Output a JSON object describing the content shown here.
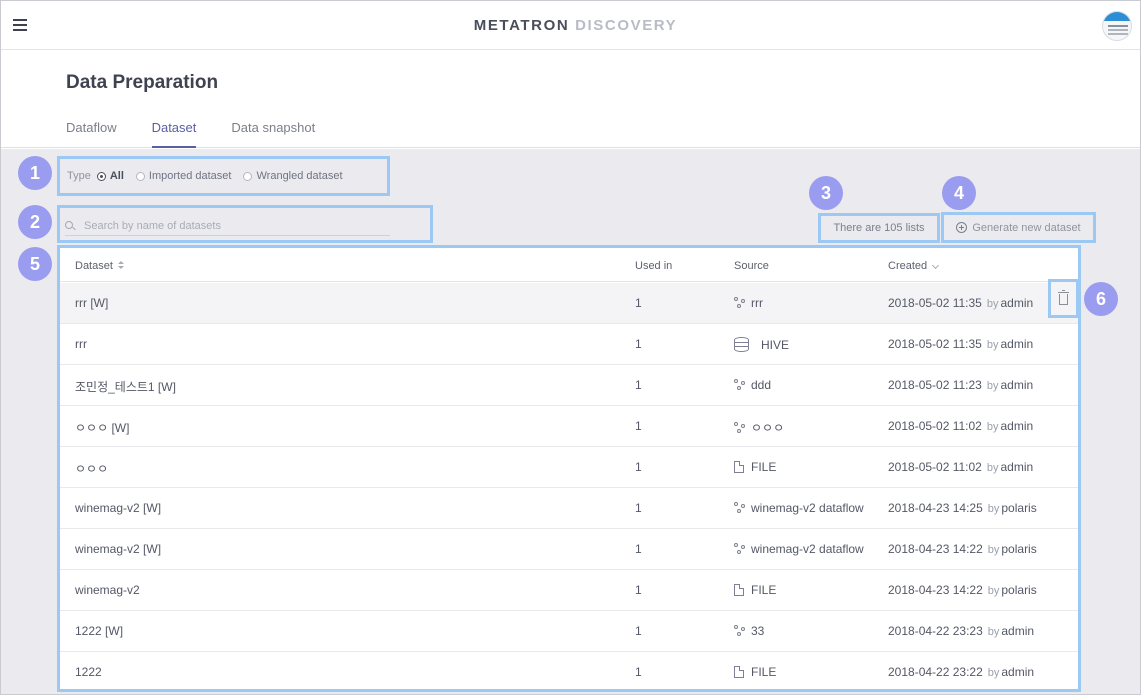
{
  "topbar": {
    "brand_primary": "METATRON",
    "brand_secondary": "DISCOVERY",
    "menu_icon": "hamburger-icon",
    "avatar_icon": "user-avatar"
  },
  "page": {
    "title": "Data Preparation",
    "tabs": [
      {
        "label": "Dataflow",
        "active": false
      },
      {
        "label": "Dataset",
        "active": true
      },
      {
        "label": "Data snapshot",
        "active": false
      }
    ]
  },
  "filter": {
    "type_label": "Type",
    "options": [
      {
        "label": "All",
        "checked": true
      },
      {
        "label": "Imported dataset",
        "checked": false
      },
      {
        "label": "Wrangled dataset",
        "checked": false
      }
    ]
  },
  "search": {
    "placeholder": "Search by name of datasets",
    "value": ""
  },
  "list_count": "There are 105 lists",
  "generate_button": "Generate new dataset",
  "table": {
    "columns": {
      "dataset": "Dataset",
      "used_in": "Used in",
      "source": "Source",
      "created": "Created"
    },
    "by_label": "by",
    "rows": [
      {
        "name": "rrr [W]",
        "used": "1",
        "source_icon": "dataflow-icon",
        "source": "rrr",
        "date": "2018-05-02 11:35",
        "user": "admin"
      },
      {
        "name": "rrr",
        "used": "1",
        "source_icon": "database-icon",
        "source": "HIVE",
        "date": "2018-05-02 11:35",
        "user": "admin"
      },
      {
        "name": "조민정_테스트1 [W]",
        "used": "1",
        "source_icon": "dataflow-icon",
        "source": "ddd",
        "date": "2018-05-02 11:23",
        "user": "admin"
      },
      {
        "name": "ㅇㅇㅇ [W]",
        "used": "1",
        "source_icon": "dataflow-icon",
        "source": "ㅇㅇㅇ",
        "date": "2018-05-02 11:02",
        "user": "admin"
      },
      {
        "name": "ㅇㅇㅇ",
        "used": "1",
        "source_icon": "file-icon",
        "source": "FILE",
        "date": "2018-05-02 11:02",
        "user": "admin"
      },
      {
        "name": "winemag-v2 [W]",
        "used": "1",
        "source_icon": "dataflow-icon",
        "source": "winemag-v2 dataflow",
        "date": "2018-04-23 14:25",
        "user": "polaris"
      },
      {
        "name": "winemag-v2 [W]",
        "used": "1",
        "source_icon": "dataflow-icon",
        "source": "winemag-v2 dataflow",
        "date": "2018-04-23 14:22",
        "user": "polaris"
      },
      {
        "name": "winemag-v2",
        "used": "1",
        "source_icon": "file-icon",
        "source": "FILE",
        "date": "2018-04-23 14:22",
        "user": "polaris"
      },
      {
        "name": "1222 [W]",
        "used": "1",
        "source_icon": "dataflow-icon",
        "source": "33",
        "date": "2018-04-22 23:23",
        "user": "admin"
      },
      {
        "name": "1222",
        "used": "1",
        "source_icon": "file-icon",
        "source": "FILE",
        "date": "2018-04-22 23:22",
        "user": "admin"
      }
    ]
  },
  "delete_icon": "trash-icon",
  "callouts": [
    "1",
    "2",
    "3",
    "4",
    "5",
    "6"
  ],
  "colors": {
    "accent": "#5a5fa5",
    "callout_badge": "#9a9cf0",
    "callout_border": "#9cc9f4",
    "content_bg": "#ebebef"
  }
}
